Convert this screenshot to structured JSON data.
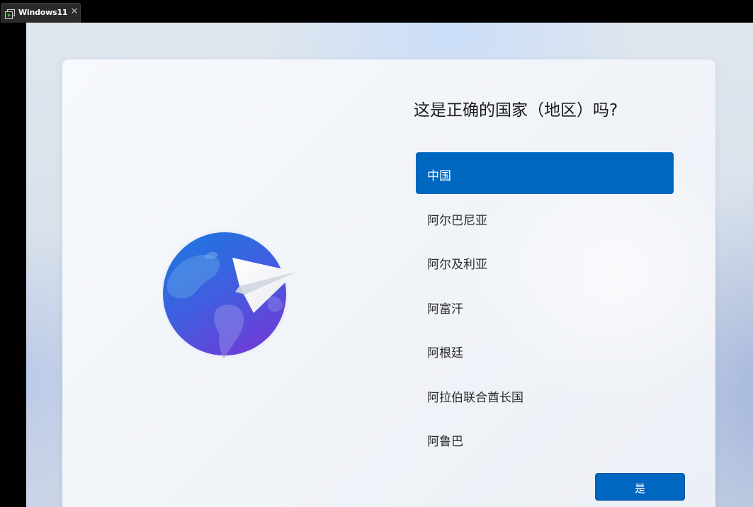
{
  "window_tab": {
    "title": "Windows11",
    "close_glyph": "✕",
    "icon": "vm-window-icon"
  },
  "oobe": {
    "title": "这是正确的国家（地区）吗?",
    "illustration": "globe-paper-plane",
    "countries": [
      {
        "label": "中国",
        "selected": true
      },
      {
        "label": "阿尔巴尼亚",
        "selected": false
      },
      {
        "label": "阿尔及利亚",
        "selected": false
      },
      {
        "label": "阿富汗",
        "selected": false
      },
      {
        "label": "阿根廷",
        "selected": false
      },
      {
        "label": "阿拉伯联合酋长国",
        "selected": false
      },
      {
        "label": "阿鲁巴",
        "selected": false
      }
    ],
    "confirm_button": "是"
  },
  "colors": {
    "accent": "#0067c0",
    "title_text": "#1b1b1b",
    "item_text": "#2b2b2b",
    "tab_bg": "#2a2a2a",
    "vm_icon_green": "#3fae3f"
  }
}
